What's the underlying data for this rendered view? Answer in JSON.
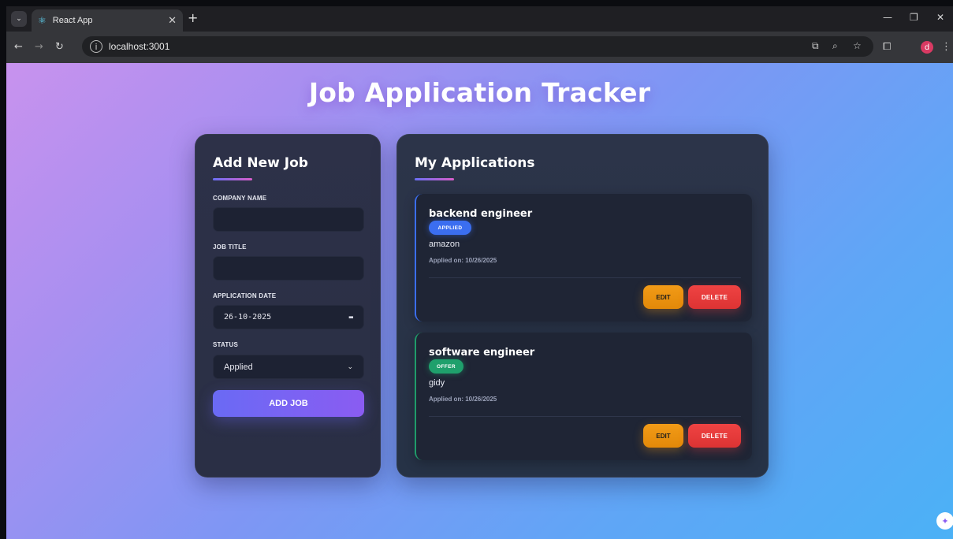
{
  "browser": {
    "tab_title": "React App",
    "url": "localhost:3001"
  },
  "page": {
    "title": "Job Application Tracker"
  },
  "form": {
    "heading": "Add New Job",
    "company_label": "COMPANY NAME",
    "company_value": "",
    "job_title_label": "JOB TITLE",
    "job_title_value": "",
    "date_label": "APPLICATION DATE",
    "date_value": "26-10-2025",
    "status_label": "STATUS",
    "status_value": "Applied",
    "submit_label": "ADD JOB"
  },
  "applications": {
    "heading": "My Applications",
    "items": [
      {
        "title": "backend engineer",
        "status": "APPLIED",
        "company": "amazon",
        "applied_on": "Applied on: 10/26/2025",
        "edit_label": "EDIT",
        "delete_label": "DELETE"
      },
      {
        "title": "software engineer",
        "status": "OFFER",
        "company": "gidy",
        "applied_on": "Applied on: 10/26/2025",
        "edit_label": "EDIT",
        "delete_label": "DELETE"
      }
    ]
  },
  "colors": {
    "accent": "#6a6af4",
    "applied": "#3b6ef0",
    "offer": "#1fa06c",
    "edit": "#f29b17",
    "delete": "#ef4343"
  }
}
